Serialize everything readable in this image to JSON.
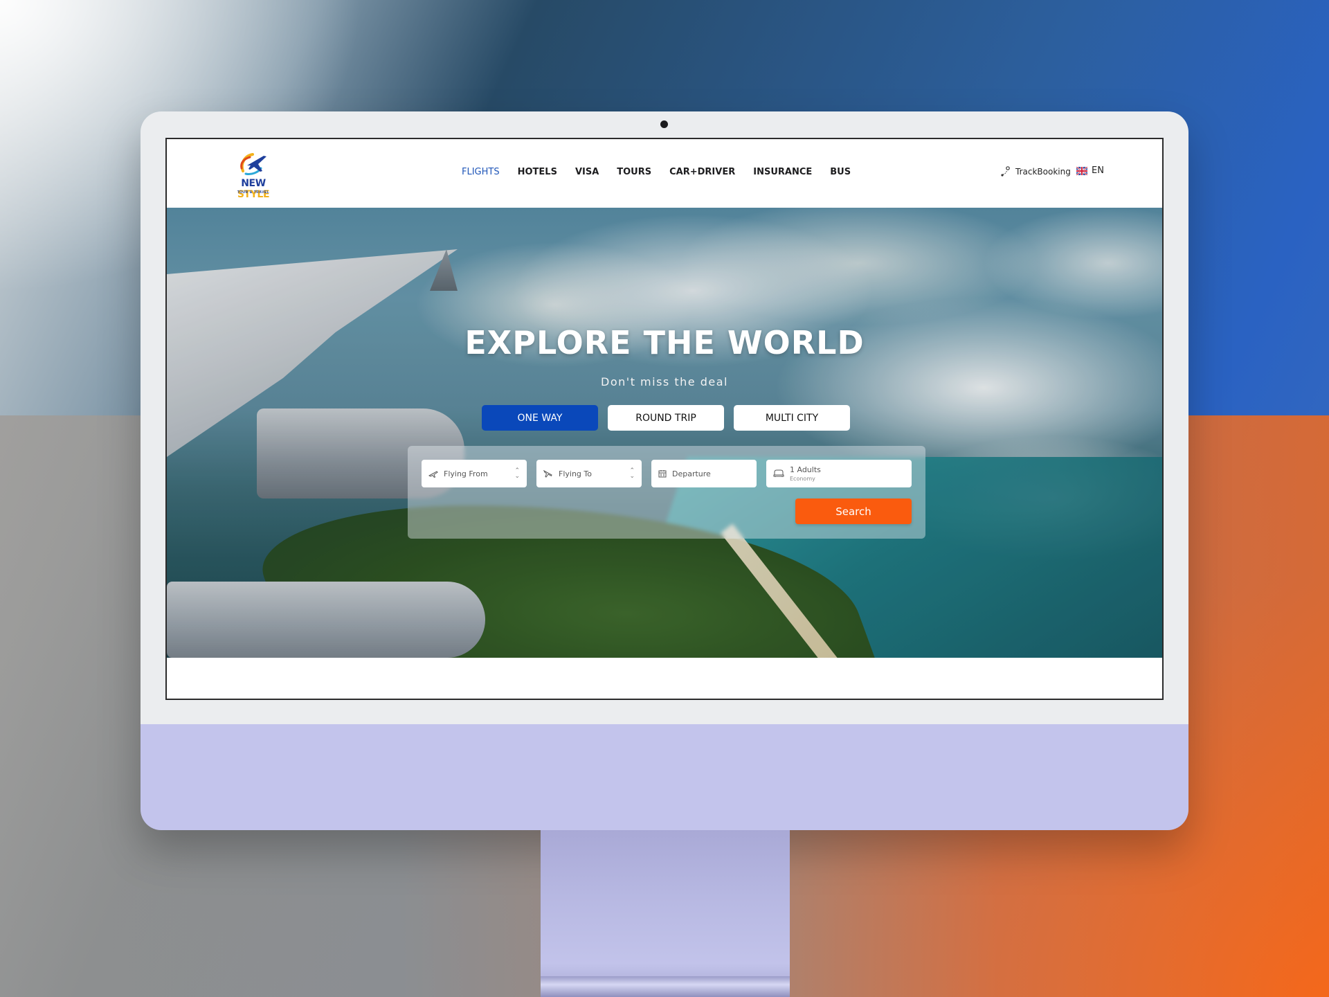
{
  "brand": {
    "name_part1": "NEW",
    "name_part2": "STYLE",
    "tagline": "TOUR & TRAVEL"
  },
  "nav": {
    "items": [
      {
        "label": "FLIGHTS",
        "active": true
      },
      {
        "label": "HOTELS",
        "active": false
      },
      {
        "label": "VISA",
        "active": false
      },
      {
        "label": "TOURS",
        "active": false
      },
      {
        "label": "CAR+DRIVER",
        "active": false
      },
      {
        "label": "INSURANCE",
        "active": false
      },
      {
        "label": "BUS",
        "active": false
      }
    ],
    "track_booking": "TrackBooking",
    "language": "EN"
  },
  "hero": {
    "title": "EXPLORE THE WORLD",
    "subtitle": "Don't miss the deal"
  },
  "trip_types": [
    "ONE WAY",
    "ROUND TRIP",
    "MULTI CITY"
  ],
  "search": {
    "flying_from": "Flying From",
    "flying_to": "Flying To",
    "departure": "Departure",
    "passengers": "1 Adults",
    "cabin_class": "Economy",
    "button": "Search"
  },
  "colors": {
    "primary_blue": "#0a48ba",
    "accent_orange": "#fa5b0e",
    "nav_active": "#1f56b8"
  },
  "icons": {
    "takeoff": "plane-takeoff-icon",
    "landing": "plane-landing-icon",
    "calendar": "calendar-icon",
    "passengers": "seat-icon",
    "track": "location-pin-icon",
    "flag": "uk-flag-icon"
  }
}
